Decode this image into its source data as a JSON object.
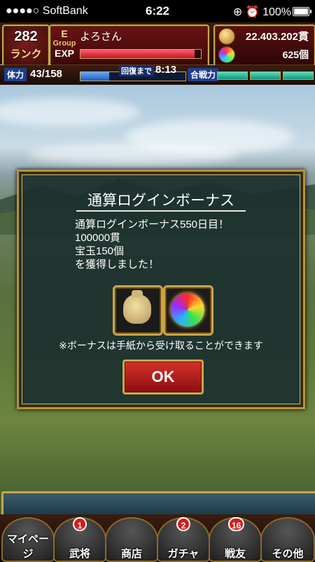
{
  "status_bar": {
    "carrier": "●●●●○ SoftBank",
    "time": "6:22",
    "right": "⊕ ⏰ 100%"
  },
  "player": {
    "rank": "282",
    "rank_label": "ランク",
    "group_letter": "E",
    "group_label": "Group",
    "name": "よろさん",
    "exp_label": "EXP",
    "exp_progress": 0.95
  },
  "currency": {
    "money": "22.403.202貫",
    "gems": "625個"
  },
  "stamina": {
    "label": "体力",
    "value": "43/158",
    "progress": 0.27,
    "recover_label": "回復まで",
    "recover_time": "8:13",
    "power_label": "合戦力"
  },
  "modal": {
    "title": "通算ログインボーナス",
    "line1": "通算ログインボーナス550日目！",
    "line2": "100000貫",
    "line3": "宝玉150個",
    "line4": "を獲得しました！",
    "note": "※ボーナスは手紙から受け取ることができます",
    "ok": "OK",
    "rewards": [
      "money-bag-icon",
      "rainbow-orb-icon"
    ]
  },
  "nav": {
    "items": [
      {
        "label": "マイページ",
        "badge": ""
      },
      {
        "label": "武将",
        "badge": "1"
      },
      {
        "label": "商店",
        "badge": ""
      },
      {
        "label": "ガチャ",
        "badge": "2"
      },
      {
        "label": "戦友",
        "badge": "16"
      },
      {
        "label": "その他",
        "badge": ""
      }
    ]
  }
}
